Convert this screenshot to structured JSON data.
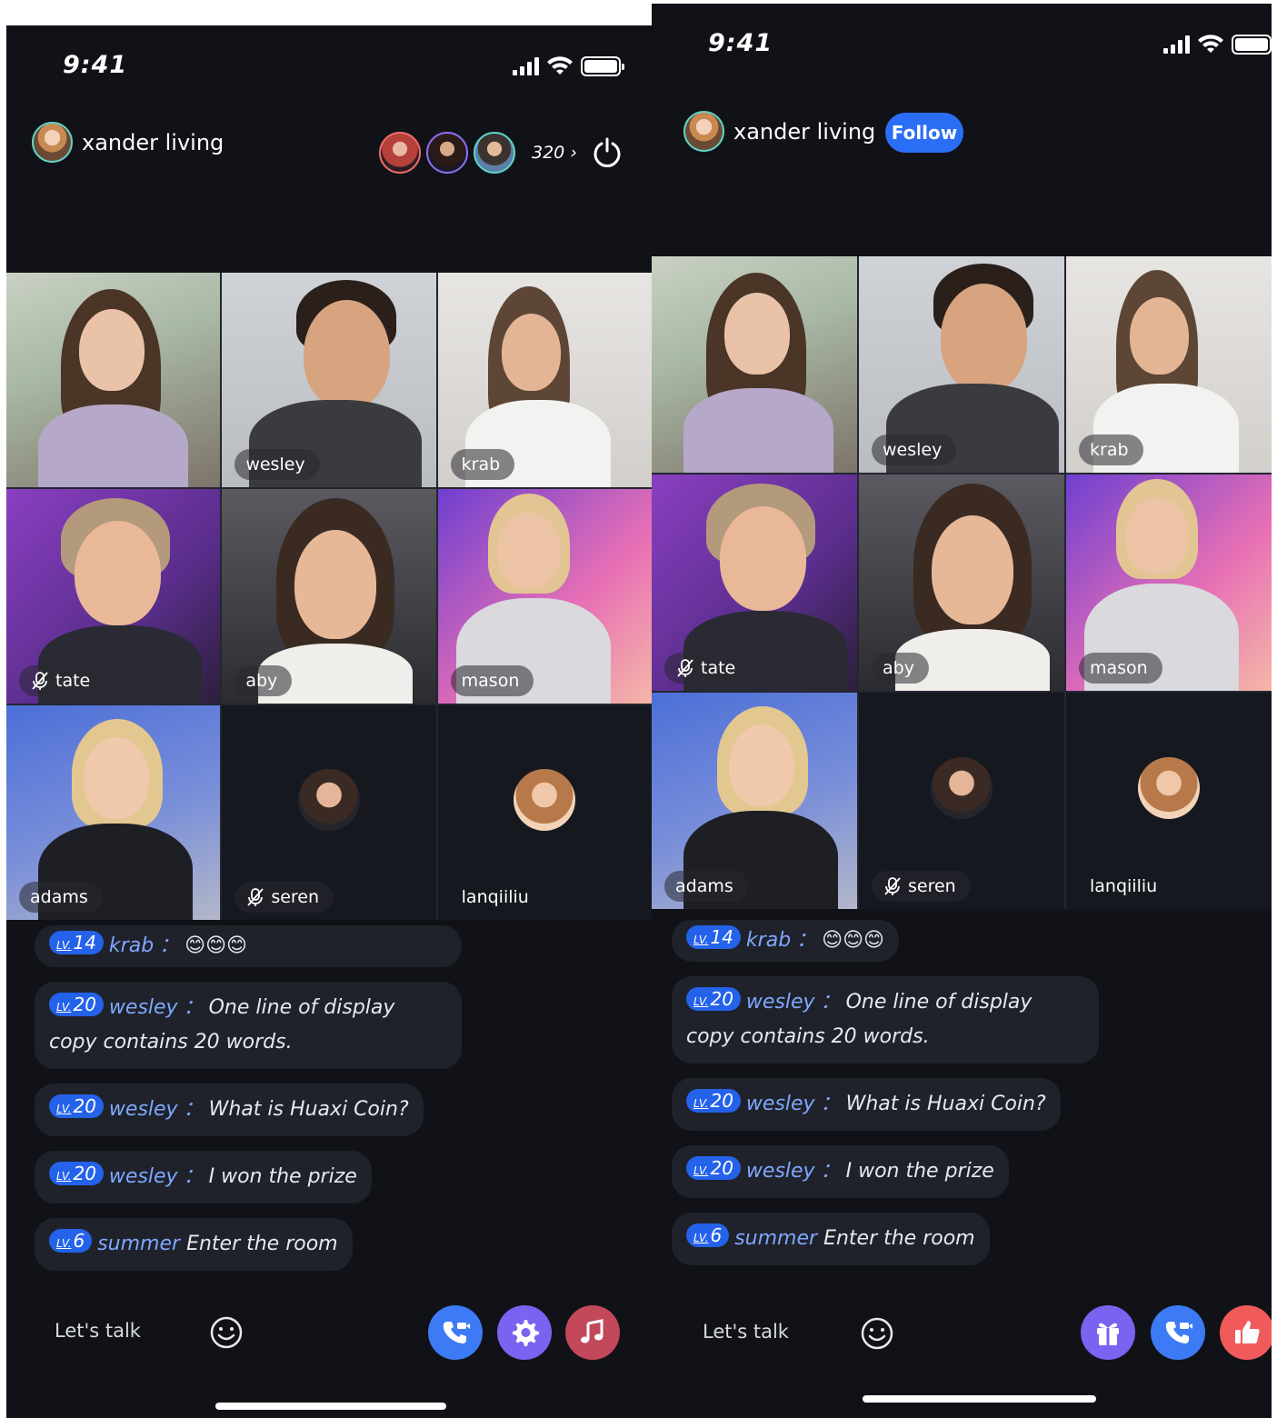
{
  "status": {
    "time": "9:41"
  },
  "host": {
    "name": "xander living"
  },
  "follow_label": "Follow",
  "viewer_count": "320",
  "participants": [
    {
      "name": "",
      "muted": false
    },
    {
      "name": "wesley",
      "muted": false
    },
    {
      "name": "krab",
      "muted": false
    },
    {
      "name": "tate",
      "muted": true
    },
    {
      "name": "aby",
      "muted": false
    },
    {
      "name": "mason",
      "muted": false
    },
    {
      "name": "adams",
      "muted": false
    },
    {
      "name": "seren",
      "muted": true
    },
    {
      "name": "lanqiiliu",
      "muted": false
    }
  ],
  "chat": [
    {
      "lv_text": "LV.",
      "level": "14",
      "user": "krab",
      "text": "😊😊😊"
    },
    {
      "lv_text": "LV.",
      "level": "20",
      "user": "wesley",
      "text": "One line of display copy contains 20 words."
    },
    {
      "lv_text": "LV.",
      "level": "20",
      "user": "wesley",
      "text": "What is Huaxi Coin?"
    },
    {
      "lv_text": "LV.",
      "level": "20",
      "user": "wesley",
      "text": "I won the prize"
    },
    {
      "lv_text": "LV.",
      "level": "6",
      "user": "summer",
      "text": "Enter the room",
      "system": true
    }
  ],
  "chat_separator": "：",
  "input": {
    "placeholder": "Let's talk"
  },
  "colors": {
    "background": "#101217",
    "accent_blue": "#2a6ef5",
    "purple": "#7c62f0",
    "music_red": "#c2485a",
    "like_red": "#f05a5a"
  }
}
